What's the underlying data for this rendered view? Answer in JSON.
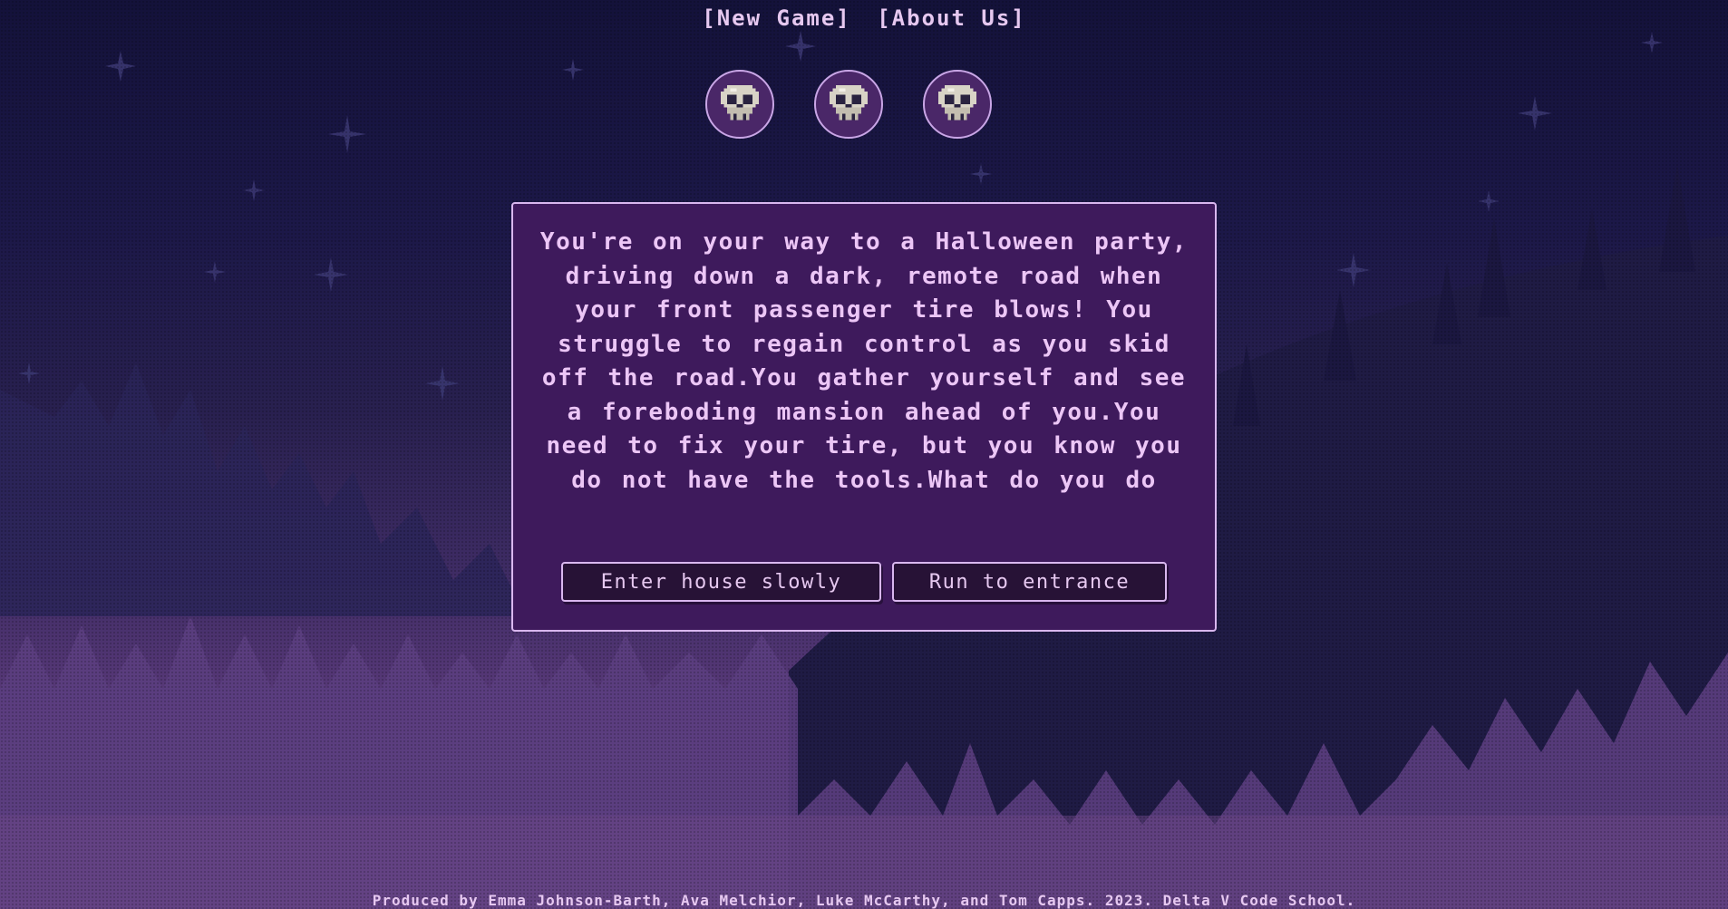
{
  "nav": {
    "new_game": "[New Game]",
    "about_us": "[About Us]"
  },
  "lives": {
    "count": 3,
    "icon": "skull-icon"
  },
  "story": {
    "text": "You're on your way to a Halloween party, driving down a dark, remote road when your front passenger tire blows! You struggle to regain control as you skid off the road.You gather yourself and see a foreboding mansion ahead of you.You need to fix your tire, but you know you do not have the tools.What do you do"
  },
  "choices": [
    {
      "label": "Enter house slowly"
    },
    {
      "label": "Run to entrance"
    }
  ],
  "footer": {
    "credits": "Produced by Emma Johnson-Barth, Ava Melchior, Luke McCarthy, and Tom Capps. 2023. Delta V Code School."
  },
  "colors": {
    "sky_top": "#14123a",
    "ground": "#6a4585",
    "box_bg": "#3e1a5c",
    "box_border": "#d9b7ef",
    "text": "#ecc6f6",
    "button_bg": "#271236"
  }
}
